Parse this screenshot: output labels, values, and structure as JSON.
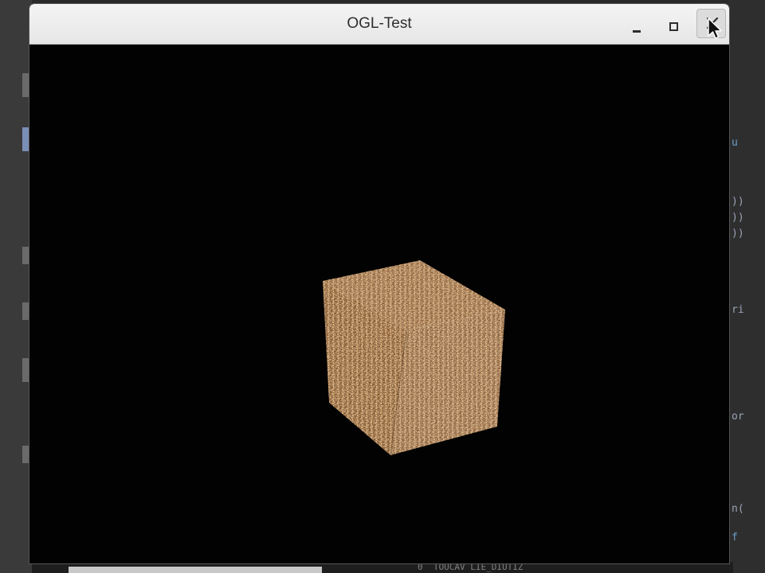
{
  "window": {
    "title": "OGL-Test"
  },
  "titlebar_buttons": {
    "minimize_icon": "minimize-icon",
    "maximize_icon": "maximize-icon",
    "close_icon": "close-icon"
  },
  "scene": {
    "object": "textured-cube",
    "background_color": "#000000",
    "texture_base_color": "#a8784a"
  },
  "background_right_fragments": [
    "u",
    "))",
    "))",
    "))",
    "ri",
    "or",
    "n(",
    "f"
  ],
  "background_bottom_fragment": "0  TOUCAV LIE_DIUTIZ"
}
